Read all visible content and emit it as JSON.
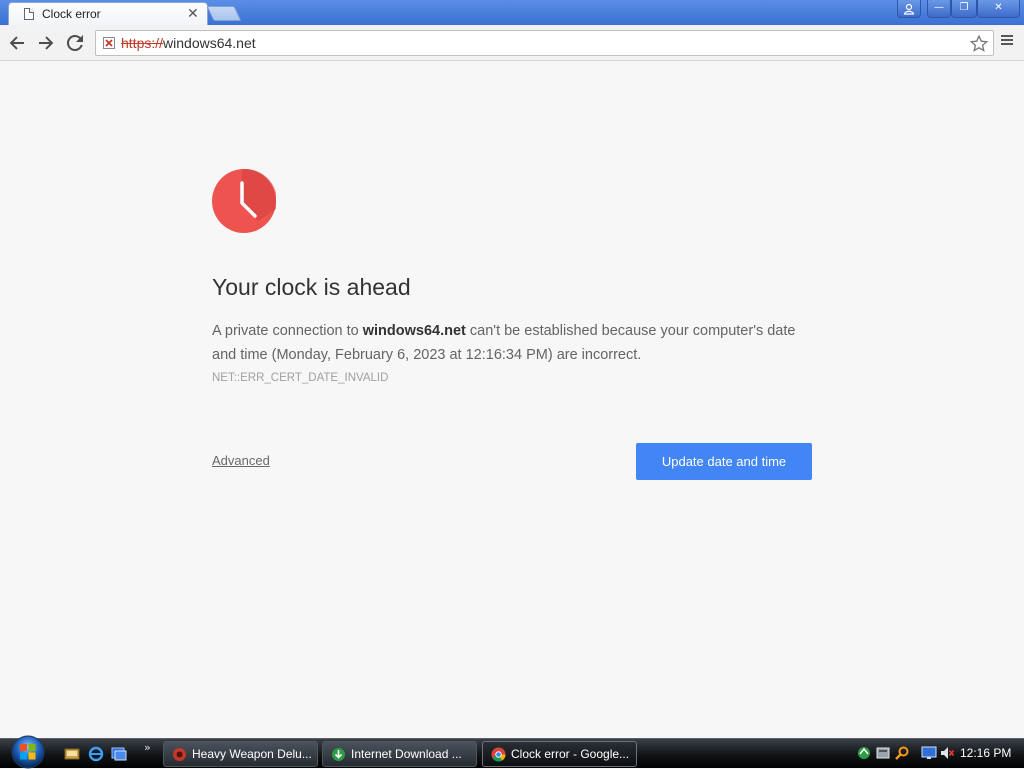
{
  "browser": {
    "tab": {
      "title": "Clock error",
      "close_glyph": "✕"
    },
    "window_buttons": {
      "minimize": "—",
      "maximize": "❐",
      "close": "✕"
    },
    "omnibox": {
      "scheme": "https://",
      "host": "windows64.net"
    }
  },
  "page": {
    "heading": "Your clock is ahead",
    "desc_before": "A private connection to ",
    "desc_host": "windows64.net",
    "desc_after": " can't be established because your computer's date and time (Monday, February 6, 2023 at 12:16:34 PM) are incorrect.",
    "error_code": "NET::ERR_CERT_DATE_INVALID",
    "advanced_link": "Advanced",
    "primary_button": "Update date and time"
  },
  "taskbar": {
    "more_glyph": "»",
    "tasks": [
      {
        "label": "Heavy Weapon Delu...",
        "active": false
      },
      {
        "label": "Internet Download ...",
        "active": false
      },
      {
        "label": "Clock error - Google...",
        "active": true
      }
    ],
    "clock": "12:16 PM"
  },
  "colors": {
    "accent_button": "#4285f4",
    "clock_icon": "#ef5350",
    "insecure_scheme": "#c53929"
  },
  "icons": [
    "page-icon",
    "back-icon",
    "forward-icon",
    "reload-icon",
    "insecure-lock-icon",
    "star-icon",
    "menu-icon",
    "clock-icon",
    "windows-start-icon"
  ]
}
